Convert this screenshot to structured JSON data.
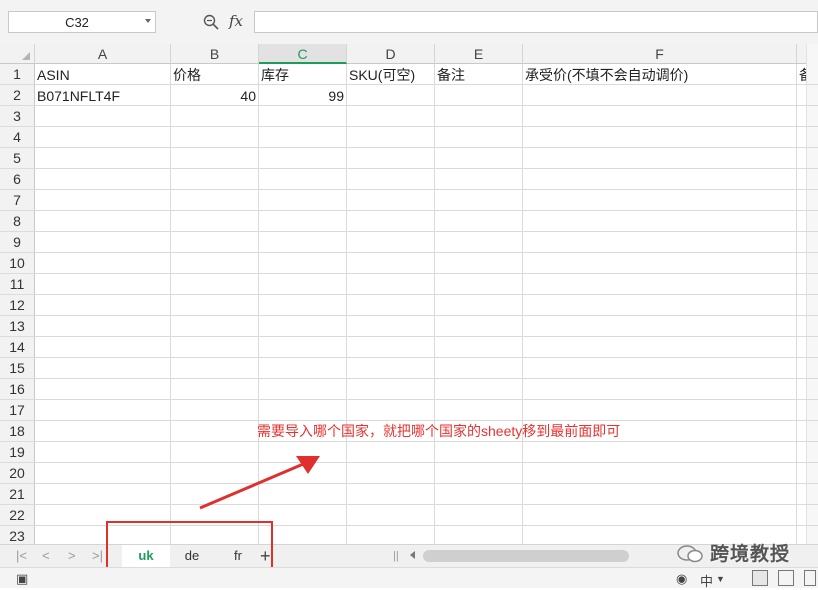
{
  "namebox": {
    "value": "C32"
  },
  "formula_bar": {
    "fx_label": "fx",
    "value": ""
  },
  "columns": [
    "A",
    "B",
    "C",
    "D",
    "E",
    "F",
    ""
  ],
  "selected_column": "C",
  "rows": [
    "1",
    "2",
    "3",
    "4",
    "5",
    "6",
    "7",
    "8",
    "9",
    "10",
    "11",
    "12",
    "13",
    "14",
    "15",
    "16",
    "17",
    "18",
    "19",
    "20",
    "21",
    "22",
    "23"
  ],
  "cells": {
    "A1": "ASIN",
    "B1": "价格",
    "C1": "库存",
    "D1": "SKU(可空)",
    "E1": "备注",
    "F1": "承受价(不填不会自动调价)",
    "G1": "备",
    "A2": "B071NFLT4F",
    "B2": "40",
    "C2": "99"
  },
  "annotation": "需要导入哪个国家，就把哪个国家的sheety移到最前面即可",
  "sheet_tabs": [
    {
      "label": "uk",
      "active": true
    },
    {
      "label": "de",
      "active": false
    },
    {
      "label": "fr",
      "active": false
    }
  ],
  "add_sheet_label": "+",
  "watermark": "跨境教授",
  "status": {
    "lang": "中"
  },
  "colors": {
    "accent_green": "#1e9c5a",
    "annotation_red": "#e8322f",
    "highlight_box": "#e0302d"
  }
}
